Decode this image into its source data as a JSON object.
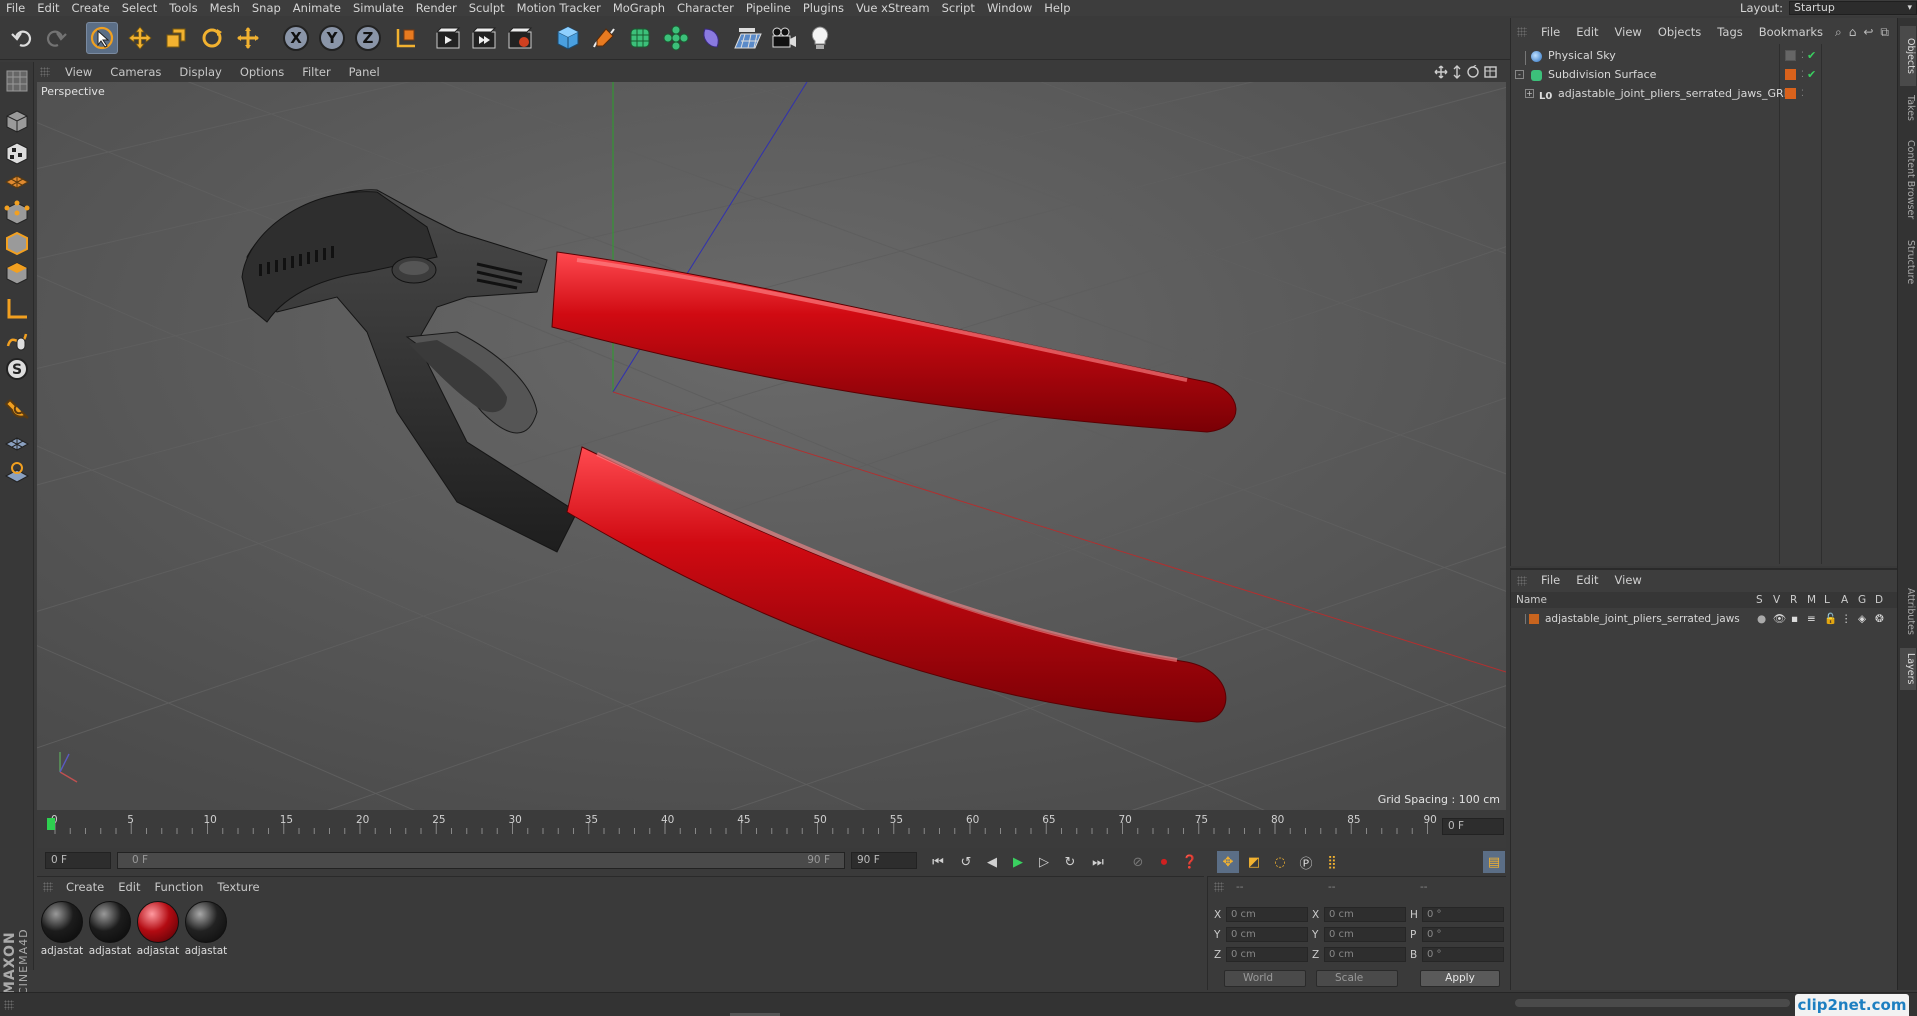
{
  "menubar": {
    "items": [
      "File",
      "Edit",
      "Create",
      "Select",
      "Tools",
      "Mesh",
      "Snap",
      "Animate",
      "Simulate",
      "Render",
      "Sculpt",
      "Motion Tracker",
      "MoGraph",
      "Character",
      "Pipeline",
      "Plugins",
      "Vue xStream",
      "Script",
      "Window",
      "Help"
    ],
    "layout_label": "Layout:",
    "layout_value": "Startup"
  },
  "toolbar": {
    "icons": [
      "undo-icon",
      "redo-icon",
      "select-live-icon",
      "move-icon",
      "scale-icon",
      "rotate-icon",
      "transform-icon",
      "x-axis-lock",
      "y-axis-lock",
      "z-axis-lock",
      "coordinate-system-icon",
      "render-view-icon",
      "render-picture-viewer-icon",
      "render-settings-icon",
      "cube-primitive-icon",
      "pen-spline-icon",
      "subdivision-generator-icon",
      "mograph-cloner-icon",
      "deformer-icon",
      "floor-environment-icon",
      "camera-icon",
      "light-icon"
    ],
    "axis_labels": {
      "x": "X",
      "y": "Y",
      "z": "Z"
    }
  },
  "viewport": {
    "menu": [
      "View",
      "Cameras",
      "Display",
      "Options",
      "Filter",
      "Panel"
    ],
    "camera_label": "Perspective",
    "grid_spacing": "Grid Spacing : 100 cm"
  },
  "timeline": {
    "ticks": [
      "0",
      "5",
      "10",
      "15",
      "20",
      "25",
      "30",
      "35",
      "40",
      "45",
      "50",
      "55",
      "60",
      "65",
      "70",
      "75",
      "80",
      "85",
      "90"
    ],
    "current_frame": "0 F",
    "start_field": "0 F",
    "range_start": "0 F",
    "range_end": "90 F",
    "end_field": "90 F"
  },
  "materials": {
    "menu": [
      "Create",
      "Edit",
      "Function",
      "Texture"
    ],
    "items": [
      {
        "label": "adjastat",
        "color": "#1c1c1c"
      },
      {
        "label": "adjastat",
        "color": "#1c1c1c"
      },
      {
        "label": "adjastat",
        "color": "#b30b12"
      },
      {
        "label": "adjastat",
        "color": "#222222"
      }
    ]
  },
  "coordinates": {
    "headers": [
      "--",
      "--",
      "--"
    ],
    "rows": [
      {
        "a": "X",
        "av": "0 cm",
        "b": "X",
        "bv": "0 cm",
        "c": "H",
        "cv": "0 °"
      },
      {
        "a": "Y",
        "av": "0 cm",
        "b": "Y",
        "bv": "0 cm",
        "c": "P",
        "cv": "0 °"
      },
      {
        "a": "Z",
        "av": "0 cm",
        "b": "Z",
        "bv": "0 cm",
        "c": "B",
        "cv": "0 °"
      }
    ],
    "world_dropdown": "World",
    "scale_dropdown": "Scale",
    "apply_button": "Apply"
  },
  "brand": {
    "maxon": "MAXON",
    "product": "CINEMA4D"
  },
  "object_manager": {
    "menu": [
      "File",
      "Edit",
      "View",
      "Objects",
      "Tags",
      "Bookmarks"
    ],
    "objects": [
      {
        "name": "Physical Sky"
      },
      {
        "name": "Subdivision Surface"
      },
      {
        "name": "adjastable_joint_pliers_serrated_jaws_GRP"
      }
    ]
  },
  "layer_manager": {
    "menu": [
      "File",
      "Edit",
      "View"
    ],
    "columns": [
      "Name",
      "S",
      "V",
      "R",
      "M",
      "L",
      "A",
      "G",
      "D"
    ],
    "layers": [
      {
        "name": "adjastable_joint_pliers_serrated_jaws",
        "color": "#c8641e"
      }
    ]
  },
  "side_tabs": [
    "Objects",
    "Takes",
    "Content Browser",
    "Structure",
    "Attributes",
    "Layers"
  ],
  "watermark": "clip2net.com",
  "colors": {
    "handle_red": "#c8070f",
    "metal_dark": "#2b2b2b",
    "ui_bg": "#3a3a3a",
    "active_blue": "#5b6e86"
  }
}
